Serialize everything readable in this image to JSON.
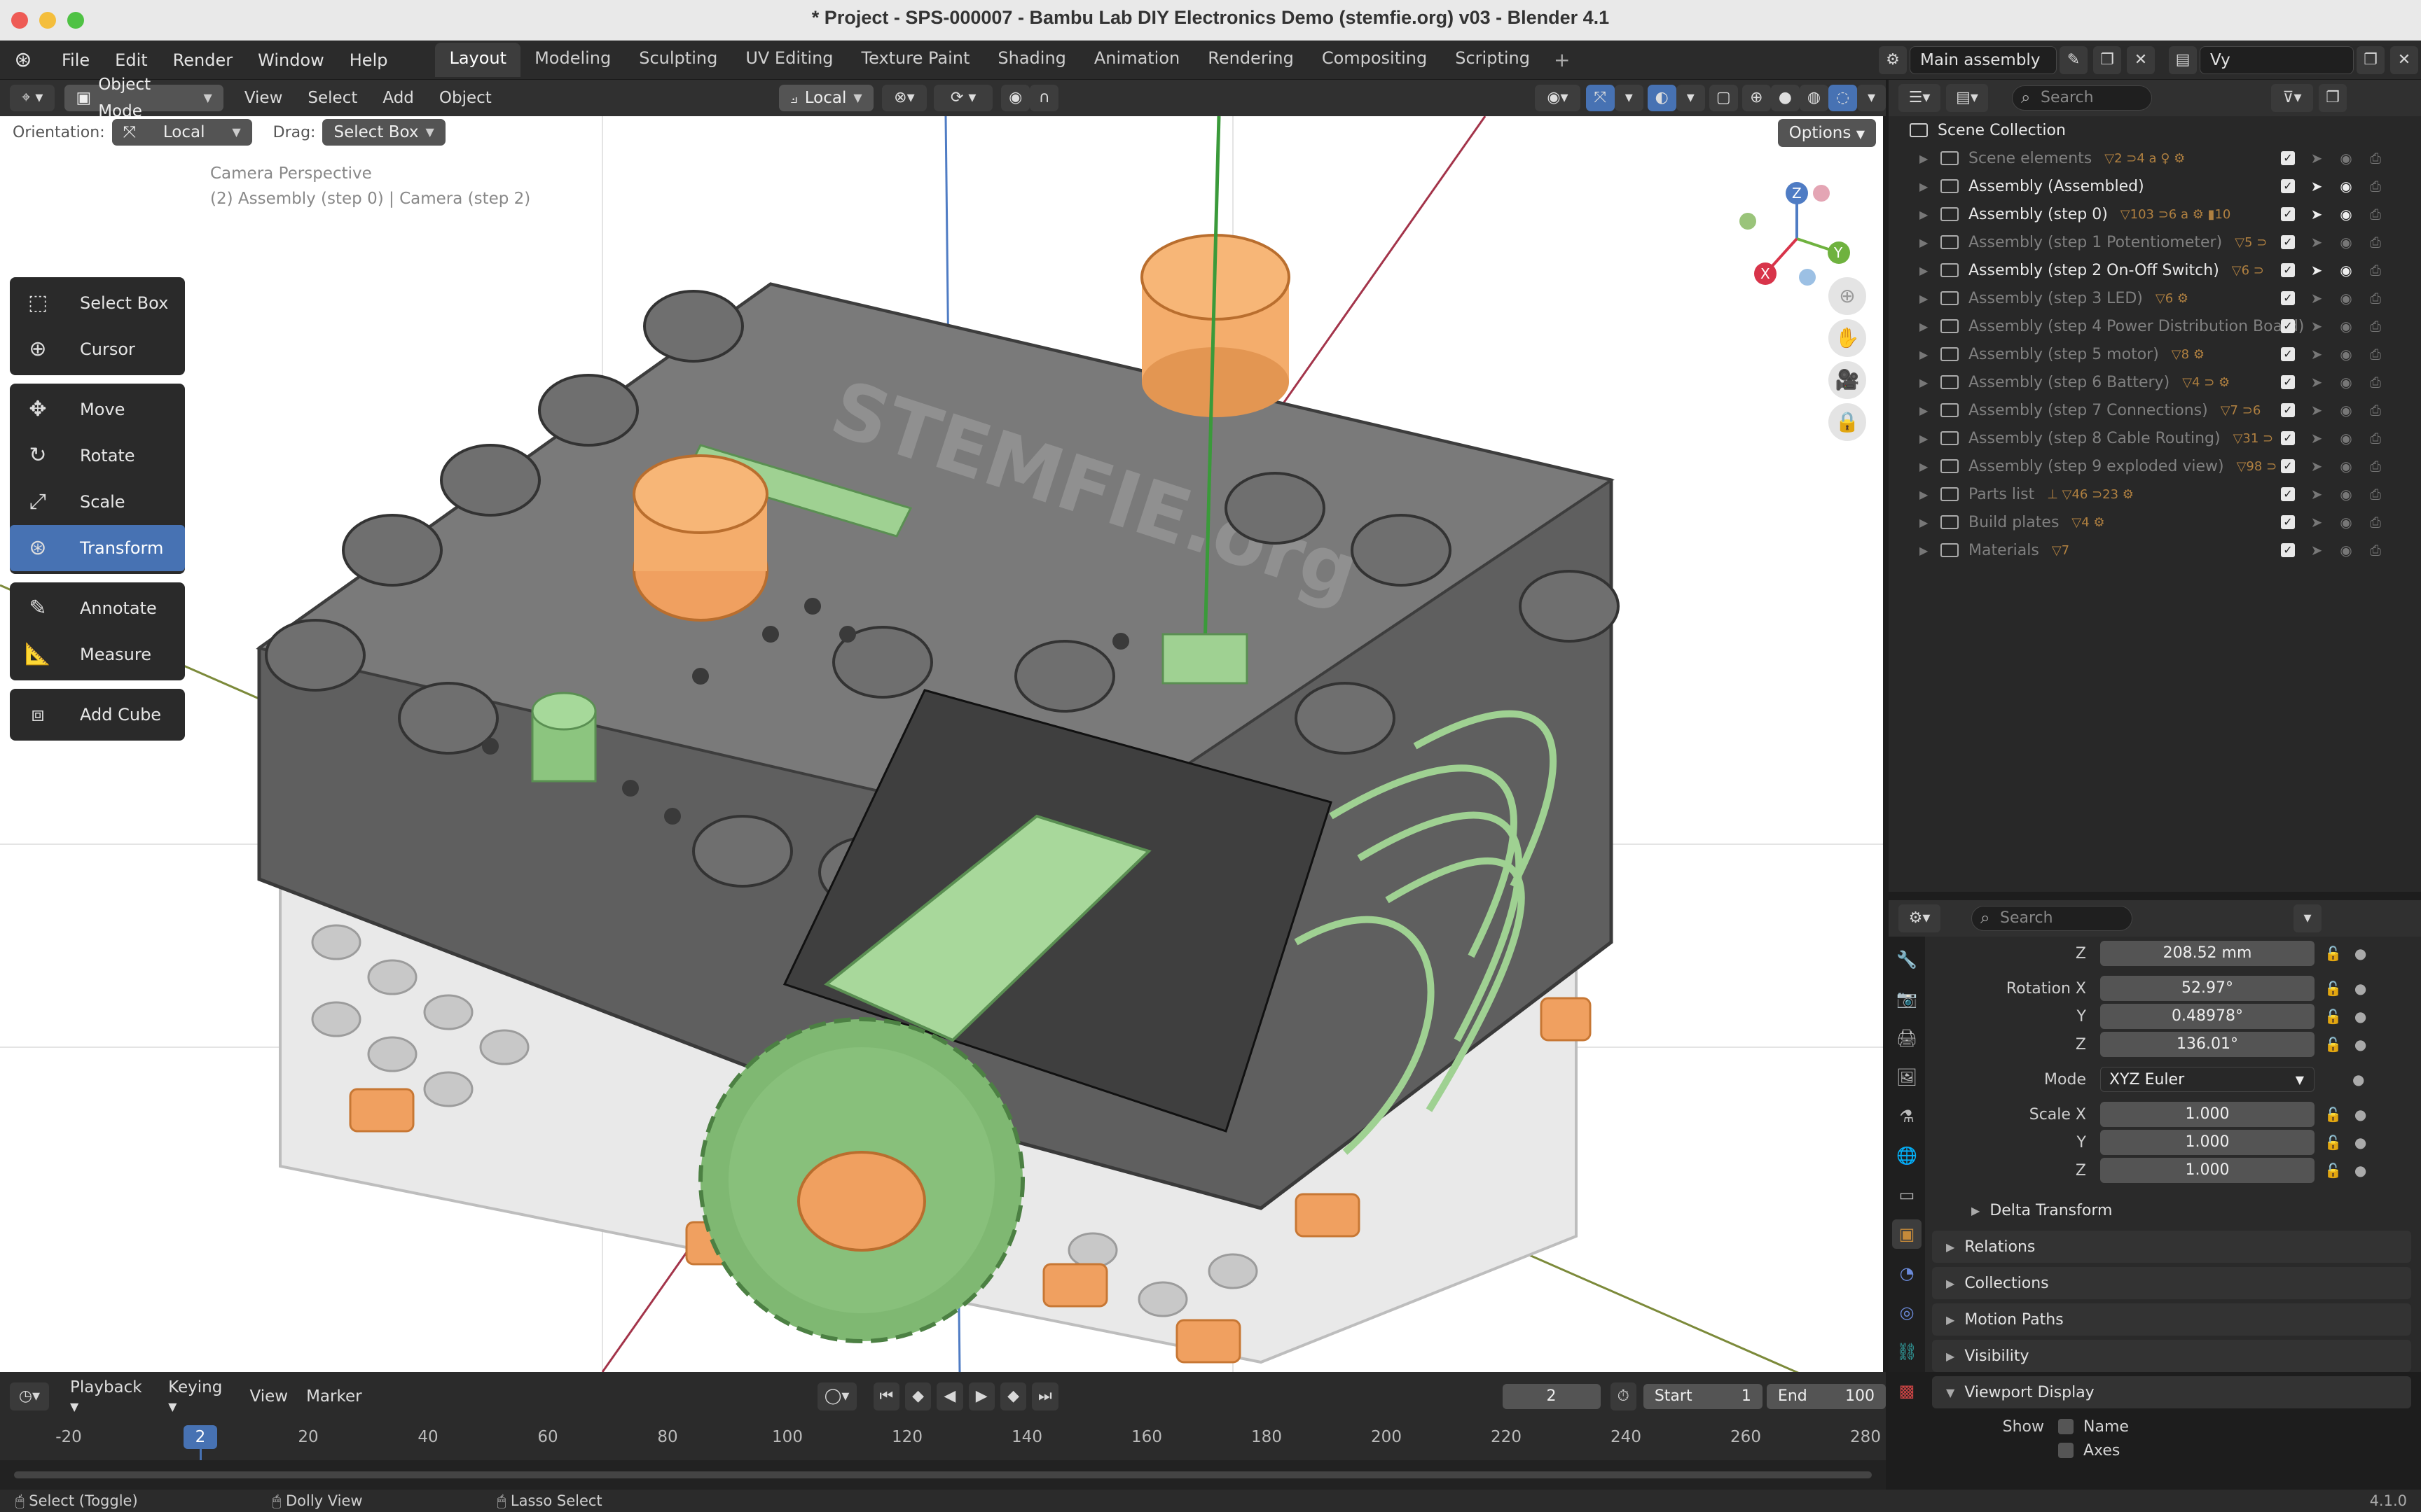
{
  "window": {
    "title": "* Project - SPS-000007 - Bambu Lab DIY Electronics Demo (stemfie.org) v03 - Blender 4.1"
  },
  "menu": [
    "File",
    "Edit",
    "Render",
    "Window",
    "Help"
  ],
  "workspaces": [
    "Layout",
    "Modeling",
    "Sculpting",
    "UV Editing",
    "Texture Paint",
    "Shading",
    "Animation",
    "Rendering",
    "Compositing",
    "Scripting"
  ],
  "active_workspace": "Layout",
  "scene": {
    "name": "Main assembly ...",
    "view_layer": "Vy"
  },
  "viewport_header": {
    "mode": "Object Mode",
    "menus": [
      "View",
      "Select",
      "Add",
      "Object"
    ],
    "pivot": "Local",
    "orientation_label": "Orientation:",
    "orientation_value": "Local",
    "drag_label": "Drag:",
    "drag_value": "Select Box",
    "options": "Options"
  },
  "viewport": {
    "camera_line1": "Camera Perspective",
    "camera_line2": "(2) Assembly (step 0) | Camera (step 2)",
    "watermark": "STEMFIE.org"
  },
  "toolbar": [
    [
      "Select Box",
      "Cursor"
    ],
    [
      "Move",
      "Rotate",
      "Scale",
      "Transform"
    ],
    [
      "Annotate",
      "Measure"
    ],
    [
      "Add Cube"
    ]
  ],
  "active_tool": "Transform",
  "outliner": {
    "search_placeholder": "Search",
    "root": "Scene Collection",
    "rows": [
      {
        "name": "Scene elements",
        "counts": "▽2 ⊃4 a ♀ ⚙",
        "dim": true
      },
      {
        "name": "Assembly (Assembled)",
        "counts": "",
        "dim": false
      },
      {
        "name": "Assembly (step 0)",
        "counts": "▽103 ⊃6 a ⚙ ▮10",
        "dim": false
      },
      {
        "name": "Assembly (step 1 Potentiometer)",
        "counts": "▽5 ⊃",
        "dim": true
      },
      {
        "name": "Assembly (step 2 On-Off Switch)",
        "counts": "▽6 ⊃",
        "dim": false
      },
      {
        "name": "Assembly (step 3 LED)",
        "counts": "▽6 ⚙",
        "dim": true
      },
      {
        "name": "Assembly (step 4 Power Distribution Board)",
        "counts": "",
        "dim": true
      },
      {
        "name": "Assembly (step 5 motor)",
        "counts": "▽8 ⚙",
        "dim": true
      },
      {
        "name": "Assembly (step 6 Battery)",
        "counts": "▽4 ⊃ ⚙",
        "dim": true
      },
      {
        "name": "Assembly (step 7 Connections)",
        "counts": "▽7 ⊃6",
        "dim": true
      },
      {
        "name": "Assembly (step 8 Cable Routing)",
        "counts": "▽31 ⊃",
        "dim": true
      },
      {
        "name": "Assembly (step 9 exploded view)",
        "counts": "▽98 ⊃",
        "dim": true
      },
      {
        "name": "Parts list",
        "counts": "⊥ ▽46 ⊃23 ⚙",
        "dim": true
      },
      {
        "name": "Build plates",
        "counts": "▽4 ⚙",
        "dim": true
      },
      {
        "name": "Materials",
        "counts": "▽7",
        "dim": true
      }
    ]
  },
  "properties": {
    "search_placeholder": "Search",
    "location_z_label": "Z",
    "location_z": "208.52 mm",
    "rotation_label": "Rotation X",
    "rotation_x": "52.97°",
    "rotation_y": "0.48978°",
    "rotation_z": "136.01°",
    "axis_y": "Y",
    "axis_z": "Z",
    "mode_label": "Mode",
    "mode_value": "XYZ Euler",
    "scale_label": "Scale X",
    "scale_x": "1.000",
    "scale_y": "1.000",
    "scale_z": "1.000",
    "sections": [
      "Delta Transform",
      "Relations",
      "Collections",
      "Motion Paths",
      "Visibility",
      "Viewport Display"
    ],
    "show_label": "Show",
    "show_name": "Name",
    "show_axes": "Axes"
  },
  "timeline": {
    "menus": [
      "Playback",
      "Keying",
      "View",
      "Marker"
    ],
    "current_frame": "2",
    "start_label": "Start",
    "start": "1",
    "end_label": "End",
    "end": "100",
    "ruler": [
      "-20",
      "2",
      "20",
      "40",
      "60",
      "80",
      "100",
      "120",
      "140",
      "160",
      "180",
      "200",
      "220",
      "240",
      "260",
      "280"
    ]
  },
  "status": {
    "items": [
      "Select (Toggle)",
      "Dolly View",
      "Lasso Select"
    ],
    "version": "4.1.0"
  }
}
